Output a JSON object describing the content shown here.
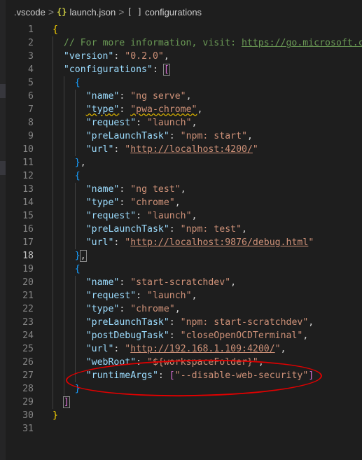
{
  "breadcrumb": {
    "folder": ".vscode",
    "file_icon": "{}",
    "file": "launch.json",
    "array_icon": "[ ]",
    "node": "configurations",
    "separator": ">"
  },
  "editor": {
    "active_line": 18,
    "lines": [
      {
        "n": "1",
        "indent": 0,
        "tokens": [
          {
            "t": "{",
            "c": "b1"
          }
        ]
      },
      {
        "n": "2",
        "indent": 1,
        "tokens": [
          {
            "t": "// For more information, visit: ",
            "c": "c"
          },
          {
            "t": "https://go.microsoft.com",
            "c": "cu"
          }
        ]
      },
      {
        "n": "3",
        "indent": 1,
        "tokens": [
          {
            "t": "\"version\"",
            "c": "k"
          },
          {
            "t": ": ",
            "c": "p"
          },
          {
            "t": "\"0.2.0\"",
            "c": "s"
          },
          {
            "t": ",",
            "c": "p"
          }
        ]
      },
      {
        "n": "4",
        "indent": 1,
        "tokens": [
          {
            "t": "\"configurations\"",
            "c": "k"
          },
          {
            "t": ": ",
            "c": "p"
          },
          {
            "t": "[",
            "c": "b2 hl"
          }
        ]
      },
      {
        "n": "5",
        "indent": 2,
        "tokens": [
          {
            "t": "{",
            "c": "b3"
          }
        ]
      },
      {
        "n": "6",
        "indent": 3,
        "tokens": [
          {
            "t": "\"name\"",
            "c": "k"
          },
          {
            "t": ": ",
            "c": "p"
          },
          {
            "t": "\"ng serve\"",
            "c": "s"
          },
          {
            "t": ",",
            "c": "p"
          }
        ]
      },
      {
        "n": "7",
        "indent": 3,
        "tokens": [
          {
            "t": "\"type\"",
            "c": "k sq"
          },
          {
            "t": ": ",
            "c": "p"
          },
          {
            "t": "\"pwa-chrome\"",
            "c": "s sq"
          },
          {
            "t": ",",
            "c": "p"
          }
        ]
      },
      {
        "n": "8",
        "indent": 3,
        "tokens": [
          {
            "t": "\"request\"",
            "c": "k"
          },
          {
            "t": ": ",
            "c": "p"
          },
          {
            "t": "\"launch\"",
            "c": "s"
          },
          {
            "t": ",",
            "c": "p"
          }
        ]
      },
      {
        "n": "9",
        "indent": 3,
        "tokens": [
          {
            "t": "\"preLaunchTask\"",
            "c": "k"
          },
          {
            "t": ": ",
            "c": "p"
          },
          {
            "t": "\"npm: start\"",
            "c": "s"
          },
          {
            "t": ",",
            "c": "p"
          }
        ]
      },
      {
        "n": "10",
        "indent": 3,
        "tokens": [
          {
            "t": "\"url\"",
            "c": "k"
          },
          {
            "t": ": ",
            "c": "p"
          },
          {
            "t": "\"",
            "c": "s"
          },
          {
            "t": "http://localhost:4200/",
            "c": "u"
          },
          {
            "t": "\"",
            "c": "s"
          }
        ]
      },
      {
        "n": "11",
        "indent": 2,
        "tokens": [
          {
            "t": "}",
            "c": "b3"
          },
          {
            "t": ",",
            "c": "p"
          }
        ]
      },
      {
        "n": "12",
        "indent": 2,
        "tokens": [
          {
            "t": "{",
            "c": "b3"
          }
        ]
      },
      {
        "n": "13",
        "indent": 3,
        "tokens": [
          {
            "t": "\"name\"",
            "c": "k"
          },
          {
            "t": ": ",
            "c": "p"
          },
          {
            "t": "\"ng test\"",
            "c": "s"
          },
          {
            "t": ",",
            "c": "p"
          }
        ]
      },
      {
        "n": "14",
        "indent": 3,
        "tokens": [
          {
            "t": "\"type\"",
            "c": "k"
          },
          {
            "t": ": ",
            "c": "p"
          },
          {
            "t": "\"chrome\"",
            "c": "s"
          },
          {
            "t": ",",
            "c": "p"
          }
        ]
      },
      {
        "n": "15",
        "indent": 3,
        "tokens": [
          {
            "t": "\"request\"",
            "c": "k"
          },
          {
            "t": ": ",
            "c": "p"
          },
          {
            "t": "\"launch\"",
            "c": "s"
          },
          {
            "t": ",",
            "c": "p"
          }
        ]
      },
      {
        "n": "16",
        "indent": 3,
        "tokens": [
          {
            "t": "\"preLaunchTask\"",
            "c": "k"
          },
          {
            "t": ": ",
            "c": "p"
          },
          {
            "t": "\"npm: test\"",
            "c": "s"
          },
          {
            "t": ",",
            "c": "p"
          }
        ]
      },
      {
        "n": "17",
        "indent": 3,
        "tokens": [
          {
            "t": "\"url\"",
            "c": "k"
          },
          {
            "t": ": ",
            "c": "p"
          },
          {
            "t": "\"",
            "c": "s"
          },
          {
            "t": "http://localhost:9876/debug.html",
            "c": "u"
          },
          {
            "t": "\"",
            "c": "s"
          }
        ]
      },
      {
        "n": "18",
        "indent": 2,
        "tokens": [
          {
            "t": "}",
            "c": "b3"
          },
          {
            "t": ",",
            "c": "p hl"
          }
        ]
      },
      {
        "n": "19",
        "indent": 2,
        "tokens": [
          {
            "t": "{",
            "c": "b3"
          }
        ]
      },
      {
        "n": "20",
        "indent": 3,
        "tokens": [
          {
            "t": "\"name\"",
            "c": "k"
          },
          {
            "t": ": ",
            "c": "p"
          },
          {
            "t": "\"start-scratchdev\"",
            "c": "s"
          },
          {
            "t": ",",
            "c": "p"
          }
        ]
      },
      {
        "n": "21",
        "indent": 3,
        "tokens": [
          {
            "t": "\"request\"",
            "c": "k"
          },
          {
            "t": ": ",
            "c": "p"
          },
          {
            "t": "\"launch\"",
            "c": "s"
          },
          {
            "t": ",",
            "c": "p"
          }
        ]
      },
      {
        "n": "22",
        "indent": 3,
        "tokens": [
          {
            "t": "\"type\"",
            "c": "k"
          },
          {
            "t": ": ",
            "c": "p"
          },
          {
            "t": "\"chrome\"",
            "c": "s"
          },
          {
            "t": ",",
            "c": "p"
          }
        ]
      },
      {
        "n": "23",
        "indent": 3,
        "tokens": [
          {
            "t": "\"preLaunchTask\"",
            "c": "k"
          },
          {
            "t": ": ",
            "c": "p"
          },
          {
            "t": "\"npm: start-scratchdev\"",
            "c": "s"
          },
          {
            "t": ",",
            "c": "p"
          }
        ]
      },
      {
        "n": "24",
        "indent": 3,
        "tokens": [
          {
            "t": "\"postDebugTask\"",
            "c": "k"
          },
          {
            "t": ": ",
            "c": "p"
          },
          {
            "t": "\"closeOpenOCDTerminal\"",
            "c": "s"
          },
          {
            "t": ",",
            "c": "p"
          }
        ]
      },
      {
        "n": "25",
        "indent": 3,
        "tokens": [
          {
            "t": "\"url\"",
            "c": "k"
          },
          {
            "t": ": ",
            "c": "p"
          },
          {
            "t": "\"",
            "c": "s"
          },
          {
            "t": "http://192.168.1.109:4200/",
            "c": "u"
          },
          {
            "t": "\"",
            "c": "s"
          },
          {
            "t": ",",
            "c": "p"
          }
        ]
      },
      {
        "n": "26",
        "indent": 3,
        "tokens": [
          {
            "t": "\"webRoot\"",
            "c": "k"
          },
          {
            "t": ": ",
            "c": "p"
          },
          {
            "t": "\"${workspaceFolder}\"",
            "c": "s"
          },
          {
            "t": ",",
            "c": "p"
          }
        ]
      },
      {
        "n": "27",
        "indent": 3,
        "tokens": [
          {
            "t": "\"runtimeArgs\"",
            "c": "k"
          },
          {
            "t": ": ",
            "c": "p"
          },
          {
            "t": "[",
            "c": "b2"
          },
          {
            "t": "\"--disable-web-security\"",
            "c": "s"
          },
          {
            "t": "]",
            "c": "b2"
          }
        ]
      },
      {
        "n": "28",
        "indent": 2,
        "tokens": [
          {
            "t": "}",
            "c": "b3"
          }
        ]
      },
      {
        "n": "29",
        "indent": 1,
        "tokens": [
          {
            "t": "]",
            "c": "b2 hl"
          }
        ]
      },
      {
        "n": "30",
        "indent": 0,
        "tokens": [
          {
            "t": "}",
            "c": "b1"
          }
        ]
      },
      {
        "n": "31",
        "indent": 0,
        "tokens": []
      }
    ]
  },
  "annotation": {
    "color": "#e00000",
    "shape": "ellipse",
    "target_line": "27"
  },
  "colors": {
    "background": "#1e1e1e",
    "key": "#9cdcfe",
    "string": "#ce9178",
    "comment": "#6a9955"
  }
}
